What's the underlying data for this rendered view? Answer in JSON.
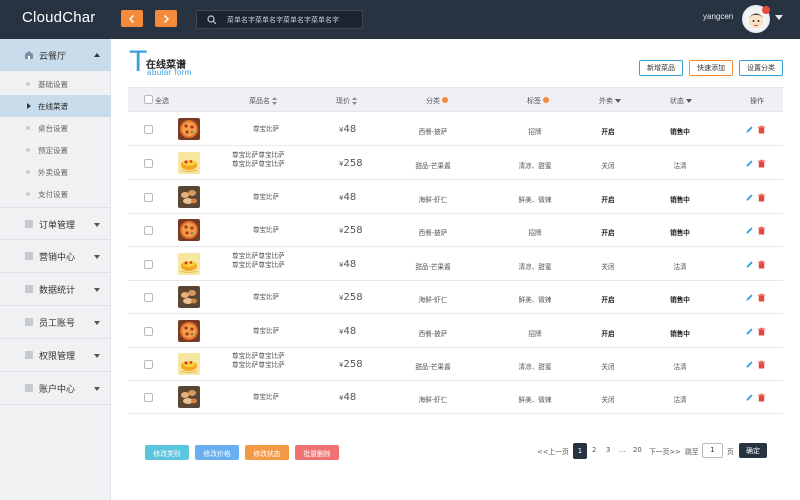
{
  "app": {
    "title": "CloudChar"
  },
  "search": {
    "placeholder": "菜单名字菜单名字菜单名字菜单名字"
  },
  "user": {
    "name": "yangcen"
  },
  "sidebar": {
    "active_section": {
      "label": "云餐厅",
      "icon": "restaurant-icon"
    },
    "sub_items": [
      {
        "label": "基础设置"
      },
      {
        "label": "在线菜谱",
        "active": true
      },
      {
        "label": "桌台设置"
      },
      {
        "label": "预定设置"
      },
      {
        "label": "外卖设置"
      },
      {
        "label": "支付设置"
      }
    ],
    "sections": [
      {
        "label": "订单管理"
      },
      {
        "label": "营销中心"
      },
      {
        "label": "数据统计"
      },
      {
        "label": "员工账号"
      },
      {
        "label": "权限管理"
      },
      {
        "label": "账户中心"
      }
    ]
  },
  "page": {
    "big_letter": "T",
    "title": "在线菜谱",
    "subtitle": "abular form",
    "buttons": {
      "add": "新增菜品",
      "quick_add": "快速添加",
      "set_category": "设置分类"
    }
  },
  "table": {
    "headers": {
      "select_all": "全选",
      "name": "菜品名",
      "price": "现价",
      "category": "分类",
      "tag": "标签",
      "takeout": "外卖",
      "status": "状态",
      "action": "操作"
    },
    "rows": [
      {
        "img": "pizza",
        "name": "尊宝比萨",
        "price": "48",
        "category": "西餐-披萨",
        "tag": "招牌",
        "takeout": "开启",
        "status": "销售中"
      },
      {
        "img": "dessert",
        "name": "尊宝比萨尊宝比萨尊宝比萨尊宝比萨",
        "price": "258",
        "category": "甜品-芒果酱",
        "tag": "清凉、甜蜜",
        "takeout": "关闭",
        "status": "沽清"
      },
      {
        "img": "shrimp",
        "name": "尊宝比萨",
        "price": "48",
        "category": "海鲜-虾仁",
        "tag": "鲜美、微辣",
        "takeout": "开启",
        "status": "销售中"
      },
      {
        "img": "pizza",
        "name": "尊宝比萨",
        "price": "258",
        "category": "西餐-披萨",
        "tag": "招牌",
        "takeout": "开启",
        "status": "销售中"
      },
      {
        "img": "dessert",
        "name": "尊宝比萨尊宝比萨尊宝比萨尊宝比萨",
        "price": "48",
        "category": "甜品-芒果酱",
        "tag": "清凉、甜蜜",
        "takeout": "关闭",
        "status": "沽清"
      },
      {
        "img": "shrimp",
        "name": "尊宝比萨",
        "price": "258",
        "category": "海鲜-虾仁",
        "tag": "鲜美、微辣",
        "takeout": "开启",
        "status": "销售中"
      },
      {
        "img": "pizza",
        "name": "尊宝比萨",
        "price": "48",
        "category": "西餐-披萨",
        "tag": "招牌",
        "takeout": "开启",
        "status": "销售中"
      },
      {
        "img": "dessert",
        "name": "尊宝比萨尊宝比萨尊宝比萨尊宝比萨",
        "price": "258",
        "category": "甜品-芒果酱",
        "tag": "清凉、甜蜜",
        "takeout": "关闭",
        "status": "沽清"
      },
      {
        "img": "shrimp",
        "name": "尊宝比萨",
        "price": "48",
        "category": "海鲜-虾仁",
        "tag": "鲜美、微辣",
        "takeout": "关闭",
        "status": "沽清"
      }
    ],
    "currency": "¥"
  },
  "footer": {
    "buttons": {
      "edit_category": "修改类别",
      "edit_price": "修改价格",
      "edit_status": "修改状态",
      "batch_delete": "批量删除"
    },
    "pager": {
      "prev": "<<上一页",
      "pages": [
        "1",
        "2",
        "3"
      ],
      "ellipsis": "...",
      "last": "20",
      "next": "下一页>>",
      "goto": "跳至",
      "current_input": "1",
      "page_unit": "页",
      "confirm": "确定"
    }
  },
  "colors": {
    "topbar": "#283342",
    "accent_orange": "#f48a3a",
    "accent_blue": "#3ba1dd",
    "btn_teal": "#5ac5dc",
    "btn_blue": "#69aef0",
    "btn_orange": "#f49a45",
    "btn_red": "#f07272",
    "delete_red": "#e8453c"
  }
}
